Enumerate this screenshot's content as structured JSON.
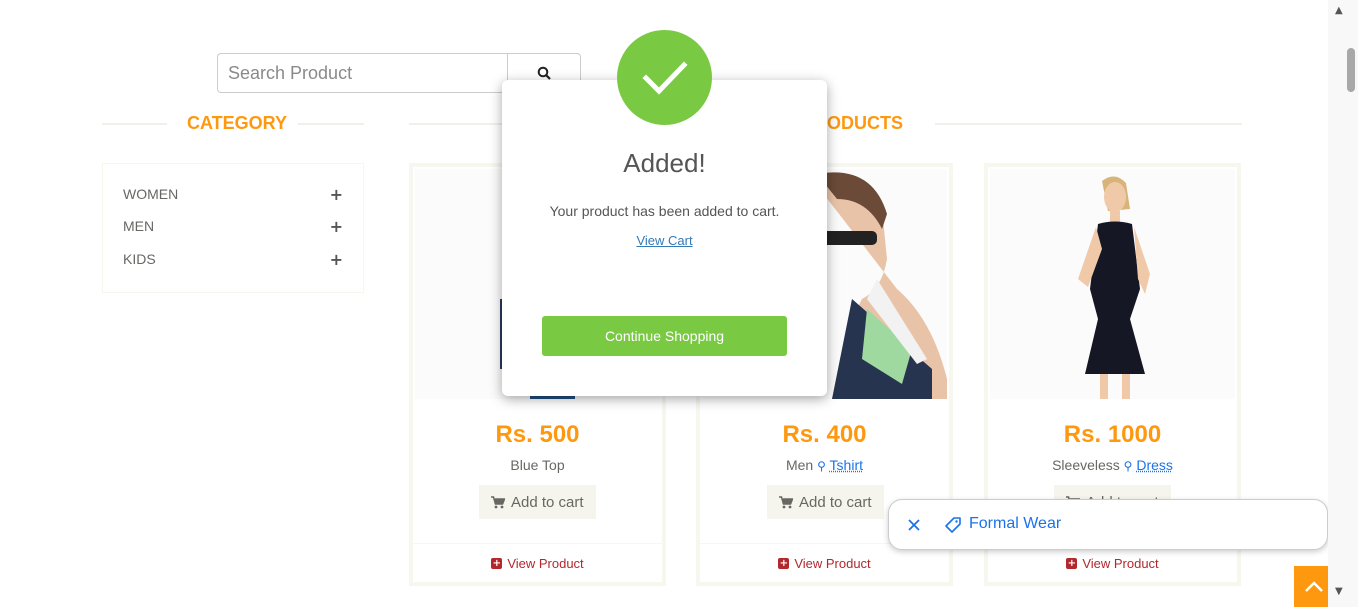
{
  "search": {
    "placeholder": "Search Product",
    "icon": "search-icon"
  },
  "sections": {
    "category_title": "CATEGORY",
    "products_title_visible": "ODUCTS"
  },
  "category": {
    "items": [
      {
        "label": "WOMEN",
        "icon": "plus-icon"
      },
      {
        "label": "MEN",
        "icon": "plus-icon"
      },
      {
        "label": "KIDS",
        "icon": "plus-icon"
      }
    ]
  },
  "products": [
    {
      "price": "Rs. 500",
      "name": "Blue Top",
      "name_link": "",
      "cart_label": "Add to cart",
      "view_label": "View Product"
    },
    {
      "price": "Rs. 400",
      "name": "Men",
      "name_link": "Tshirt",
      "cart_label": "Add to cart",
      "view_label": "View Product"
    },
    {
      "price": "Rs. 1000",
      "name": "Sleeveless",
      "name_link": "Dress",
      "cart_label": "Add to cart",
      "view_label": "View Product"
    }
  ],
  "modal": {
    "title": "Added!",
    "message": "Your product has been added to cart.",
    "link": "View Cart",
    "button": "Continue Shopping",
    "icon": "checkmark-icon",
    "accent": "#7AC943"
  },
  "chip": {
    "label": "Formal Wear",
    "close_icon": "close-icon",
    "tag_icon": "tag-icon"
  },
  "colors": {
    "accent": "#FE980F",
    "success": "#7AC943",
    "link": "#1a73e8",
    "view_product": "#B3282D"
  }
}
